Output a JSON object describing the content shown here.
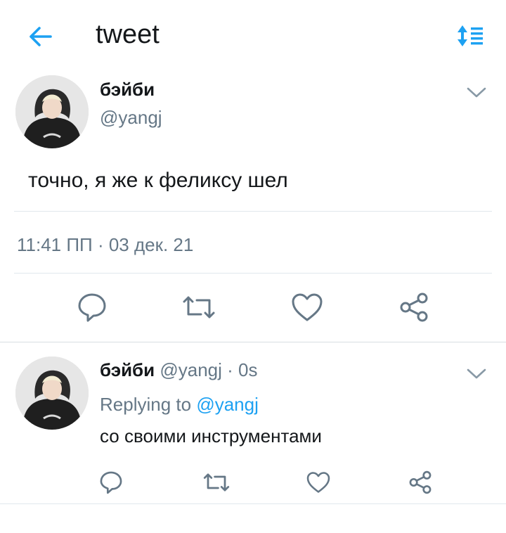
{
  "header": {
    "title": "tweet",
    "back_icon": "arrow-left-icon",
    "sort_icon": "sort-list-icon",
    "accent": "#1da1f2"
  },
  "main_tweet": {
    "name": "бэйби",
    "handle": "@yangj",
    "text": "точно, я же к феликсу шел",
    "timestamp": "11:41 ПП · 03 дек. 21",
    "actions": [
      "reply-icon",
      "retweet-icon",
      "like-icon",
      "share-icon"
    ]
  },
  "reply_tweet": {
    "name": "бэйби",
    "handle": "@yangj",
    "separator": "·",
    "time": "0s",
    "replying_prefix": "Replying to",
    "replying_to": "@yangj",
    "text": "со своими инструментами",
    "actions": [
      "reply-icon",
      "retweet-icon",
      "like-icon",
      "share-icon"
    ]
  },
  "colors": {
    "text": "#14171a",
    "secondary": "#657786",
    "link": "#1da1f2",
    "divider": "#e1e8ed"
  }
}
